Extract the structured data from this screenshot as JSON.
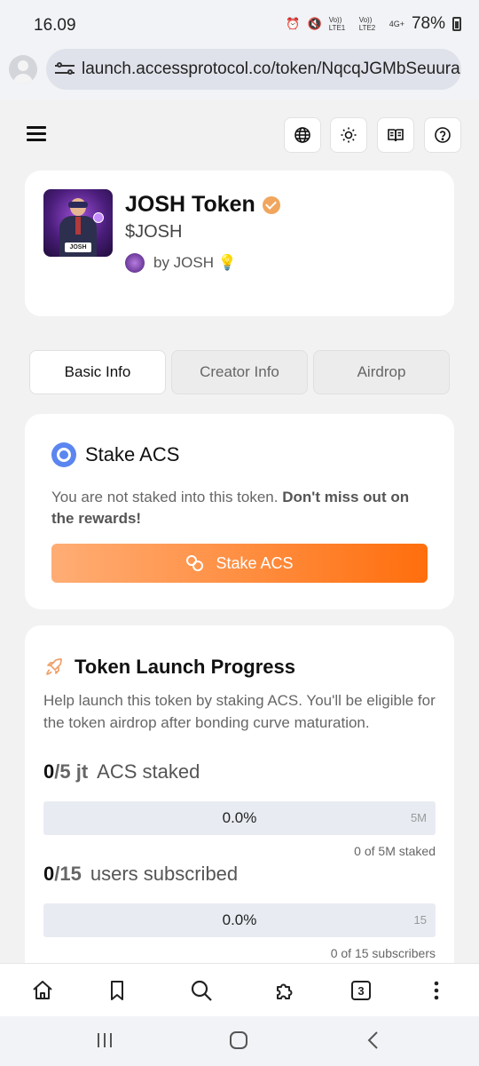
{
  "status_bar": {
    "time": "16.09",
    "network": [
      "Vo)) LTE1",
      "Vo)) LTE2",
      "4G+"
    ],
    "battery": "78%"
  },
  "address_bar": {
    "url": "launch.accessprotocol.co/token/NqcqJGMbSeuura"
  },
  "token": {
    "name": "JOSH Token",
    "ticker": "$JOSH",
    "creator": "by JOSH 💡",
    "logo_label": "JOSH"
  },
  "tabs": [
    {
      "label": "Basic Info",
      "active": true
    },
    {
      "label": "Creator Info",
      "active": false
    },
    {
      "label": "Airdrop",
      "active": false
    }
  ],
  "stake": {
    "title": "Stake ACS",
    "message": "You are not staked into this token.",
    "message_bold": "Don't miss out on the rewards!",
    "button_label": "Stake ACS"
  },
  "progress": {
    "title": "Token Launch Progress",
    "description": "Help launch this token by staking ACS. You'll be eligible for the token airdrop after bonding curve maturation.",
    "acs": {
      "current": "0",
      "target": "/5 jt",
      "unit": "ACS staked",
      "percent_label": "0.0%",
      "percent": 0,
      "max_label": "5M",
      "note": "0 of 5M staked"
    },
    "users": {
      "current": "0",
      "target": "/15",
      "unit": "users subscribed",
      "percent_label": "0.0%",
      "percent": 0,
      "max_label": "15",
      "note": "0 of 15 subscribers"
    }
  },
  "browser_toolbar": {
    "tab_count": "3"
  },
  "colors": {
    "accent": "#ff8c3d",
    "verified": "#f0a65e",
    "acs_blue": "#5b86f0"
  }
}
